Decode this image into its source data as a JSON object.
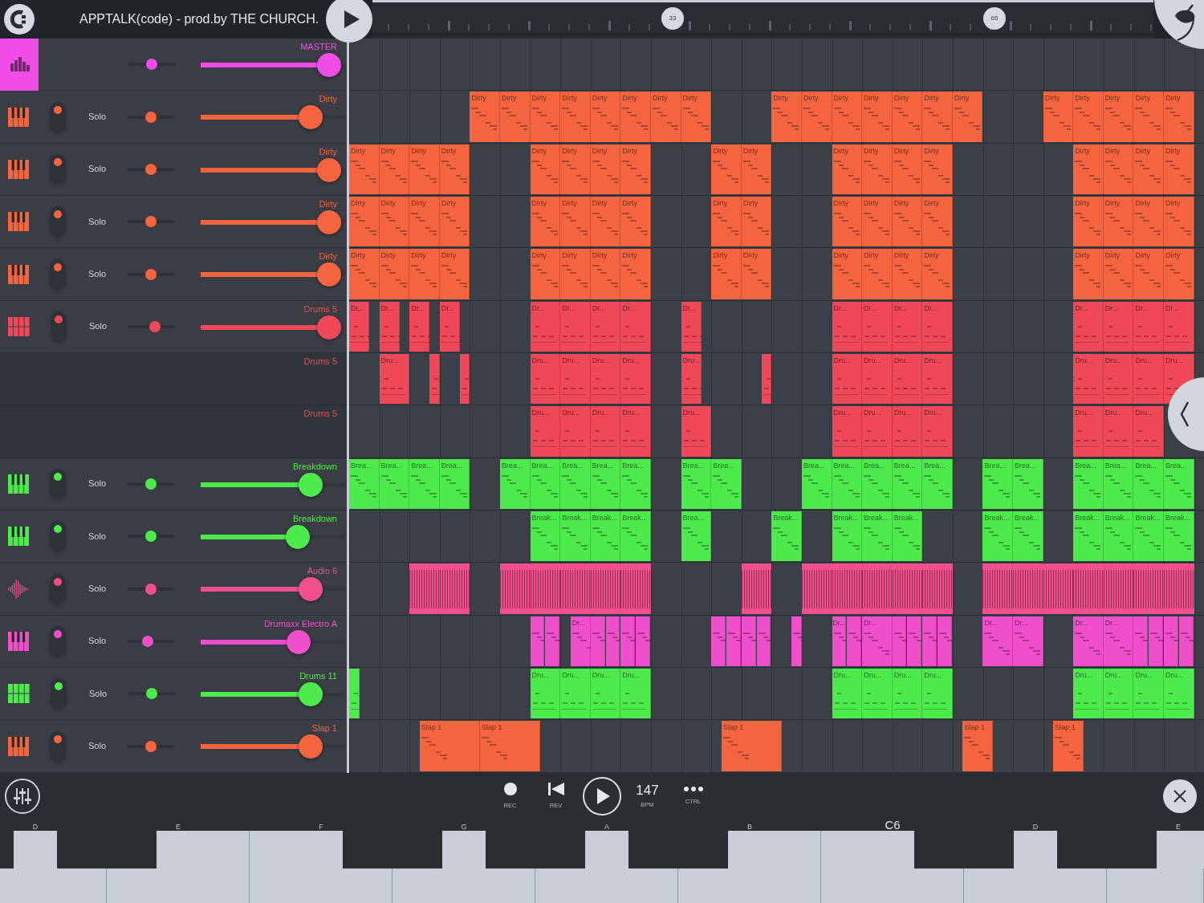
{
  "header": {
    "title": "APPTALK(code) - prod.by THE CHURCH.",
    "markers": [
      "33",
      "65"
    ]
  },
  "tracks": [
    {
      "kind": "master",
      "name": "MASTER",
      "color": "#f04ce6",
      "pan": {
        "level": 0.5
      },
      "volume": {
        "level": 0.89
      }
    },
    {
      "kind": "keys",
      "name": "Dirty",
      "color": "#f4653f",
      "on": true,
      "solo": "Solo",
      "pan": {
        "level": 0.5
      },
      "volume": {
        "level": 0.76
      },
      "slots": [
        {
          "kind": "rest"
        },
        {
          "kind": "rest"
        },
        {
          "kind": "rest"
        },
        {
          "kind": "rest"
        },
        {
          "kind": "pattern",
          "label": "Dirty"
        },
        {
          "kind": "pattern",
          "label": "Dirty"
        },
        {
          "kind": "pattern",
          "label": "Dirty"
        },
        {
          "kind": "pattern",
          "label": "Dirty"
        },
        {
          "kind": "pattern",
          "label": "Dirty"
        },
        {
          "kind": "pattern",
          "label": "Dirty"
        },
        {
          "kind": "pattern",
          "label": "Dirty"
        },
        {
          "kind": "pattern",
          "label": "Dirty"
        },
        {
          "kind": "rest"
        },
        {
          "kind": "rest"
        },
        {
          "kind": "pattern",
          "label": "Dirty"
        },
        {
          "kind": "pattern",
          "label": "Dirty"
        },
        {
          "kind": "pattern",
          "label": "Dirty"
        },
        {
          "kind": "pattern",
          "label": "Dirty"
        },
        {
          "kind": "pattern",
          "label": "Dirty"
        },
        {
          "kind": "pattern",
          "label": "Dirty"
        },
        {
          "kind": "pattern",
          "label": "Dirty"
        },
        {
          "kind": "rest"
        },
        {
          "kind": "rest"
        },
        {
          "kind": "pattern",
          "label": "Dirty"
        },
        {
          "kind": "pattern",
          "label": "Dirty"
        },
        {
          "kind": "pattern",
          "label": "Dirty"
        },
        {
          "kind": "pattern",
          "label": "Dirty"
        },
        {
          "kind": "pattern",
          "label": "Dirty"
        }
      ]
    },
    {
      "kind": "keys",
      "name": "Dirty",
      "color": "#f4653f",
      "on": true,
      "solo": "Solo",
      "pan": {
        "level": 0.5
      },
      "volume": {
        "level": 0.89
      },
      "slots": [
        {
          "kind": "pattern",
          "label": "Dirty"
        },
        {
          "kind": "pattern",
          "label": "Dirty"
        },
        {
          "kind": "pattern",
          "label": "Dirty"
        },
        {
          "kind": "pattern",
          "label": "Dirty"
        },
        {
          "kind": "rest"
        },
        {
          "kind": "rest"
        },
        {
          "kind": "pattern",
          "label": "Dirty"
        },
        {
          "kind": "pattern",
          "label": "Dirty"
        },
        {
          "kind": "pattern",
          "label": "Dirty"
        },
        {
          "kind": "pattern",
          "label": "Dirty"
        },
        {
          "kind": "rest"
        },
        {
          "kind": "rest"
        },
        {
          "kind": "pattern",
          "label": "Dirty"
        },
        {
          "kind": "pattern",
          "label": "Dirty"
        },
        {
          "kind": "rest"
        },
        {
          "kind": "rest"
        },
        {
          "kind": "pattern",
          "label": "Dirty"
        },
        {
          "kind": "pattern",
          "label": "Dirty"
        },
        {
          "kind": "pattern",
          "label": "Dirty"
        },
        {
          "kind": "pattern",
          "label": "Dirty"
        },
        {
          "kind": "rest"
        },
        {
          "kind": "rest"
        },
        {
          "kind": "rest"
        },
        {
          "kind": "rest"
        },
        {
          "kind": "pattern",
          "label": "Dirty"
        },
        {
          "kind": "pattern",
          "label": "Dirty"
        },
        {
          "kind": "pattern",
          "label": "Dirty"
        },
        {
          "kind": "pattern",
          "label": "Dirty"
        }
      ]
    },
    {
      "kind": "keys",
      "name": "Dirty",
      "color": "#f4653f",
      "on": true,
      "solo": "Solo",
      "pan": {
        "level": 0.5
      },
      "volume": {
        "level": 0.89
      },
      "slots": [
        {
          "kind": "pattern",
          "label": "Dirty"
        },
        {
          "kind": "pattern",
          "label": "Dirty"
        },
        {
          "kind": "pattern",
          "label": "Dirty"
        },
        {
          "kind": "pattern",
          "label": "Dirty"
        },
        {
          "kind": "rest"
        },
        {
          "kind": "rest"
        },
        {
          "kind": "pattern",
          "label": "Dirty"
        },
        {
          "kind": "pattern",
          "label": "Dirty"
        },
        {
          "kind": "pattern",
          "label": "Dirty"
        },
        {
          "kind": "pattern",
          "label": "Dirty"
        },
        {
          "kind": "rest"
        },
        {
          "kind": "rest"
        },
        {
          "kind": "pattern",
          "label": "Dirty"
        },
        {
          "kind": "pattern",
          "label": "Dirty"
        },
        {
          "kind": "rest"
        },
        {
          "kind": "rest"
        },
        {
          "kind": "pattern",
          "label": "Dirty"
        },
        {
          "kind": "pattern",
          "label": "Dirty"
        },
        {
          "kind": "pattern",
          "label": "Dirty"
        },
        {
          "kind": "pattern",
          "label": "Dirty"
        },
        {
          "kind": "rest"
        },
        {
          "kind": "rest"
        },
        {
          "kind": "rest"
        },
        {
          "kind": "rest"
        },
        {
          "kind": "pattern",
          "label": "Dirty"
        },
        {
          "kind": "pattern",
          "label": "Dirty"
        },
        {
          "kind": "pattern",
          "label": "Dirty"
        },
        {
          "kind": "pattern",
          "label": "Dirty"
        }
      ]
    },
    {
      "kind": "keys",
      "name": "Dirty",
      "color": "#f4653f",
      "on": true,
      "solo": "Solo",
      "pan": {
        "level": 0.5
      },
      "volume": {
        "level": 0.89
      },
      "slots": [
        {
          "kind": "pattern",
          "label": "Dirty"
        },
        {
          "kind": "pattern",
          "label": "Dirty"
        },
        {
          "kind": "pattern",
          "label": "Dirty"
        },
        {
          "kind": "pattern",
          "label": "Dirty"
        },
        {
          "kind": "rest"
        },
        {
          "kind": "rest"
        },
        {
          "kind": "pattern",
          "label": "Dirty"
        },
        {
          "kind": "pattern",
          "label": "Dirty"
        },
        {
          "kind": "pattern",
          "label": "Dirty"
        },
        {
          "kind": "pattern",
          "label": "Dirty"
        },
        {
          "kind": "rest"
        },
        {
          "kind": "rest"
        },
        {
          "kind": "pattern",
          "label": "Dirty"
        },
        {
          "kind": "pattern",
          "label": "Dirty"
        },
        {
          "kind": "rest"
        },
        {
          "kind": "rest"
        },
        {
          "kind": "pattern",
          "label": "Dirty"
        },
        {
          "kind": "pattern",
          "label": "Dirty"
        },
        {
          "kind": "pattern",
          "label": "Dirty"
        },
        {
          "kind": "pattern",
          "label": "Dirty"
        },
        {
          "kind": "rest"
        },
        {
          "kind": "rest"
        },
        {
          "kind": "rest"
        },
        {
          "kind": "rest"
        },
        {
          "kind": "pattern",
          "label": "Dirty"
        },
        {
          "kind": "pattern",
          "label": "Dirty"
        },
        {
          "kind": "pattern",
          "label": "Dirty"
        },
        {
          "kind": "pattern",
          "label": "Dirty"
        }
      ]
    },
    {
      "kind": "drums",
      "name": "Drums 5",
      "color": "#ef4858",
      "on": true,
      "solo": "Solo",
      "pan": {
        "level": 0.57
      },
      "volume": {
        "level": 0.89
      },
      "slots": [
        {
          "kind": "short",
          "label": "Dr..."
        },
        {
          "kind": "short",
          "label": "Dr..."
        },
        {
          "kind": "short",
          "label": "Dr..."
        },
        {
          "kind": "short",
          "label": "Dr..."
        },
        {
          "kind": "rest"
        },
        {
          "kind": "rest"
        },
        {
          "kind": "pattern",
          "label": "Dr..."
        },
        {
          "kind": "pattern",
          "label": "Dr..."
        },
        {
          "kind": "pattern",
          "label": "Dr..."
        },
        {
          "kind": "pattern",
          "label": "Dr..."
        },
        {
          "kind": "rest"
        },
        {
          "kind": "short",
          "label": "Dr..."
        },
        {
          "kind": "rest"
        },
        {
          "kind": "rest"
        },
        {
          "kind": "rest"
        },
        {
          "kind": "rest"
        },
        {
          "kind": "pattern",
          "label": "Dr..."
        },
        {
          "kind": "pattern",
          "label": "Dr..."
        },
        {
          "kind": "pattern",
          "label": "Dr..."
        },
        {
          "kind": "pattern",
          "label": "Dr..."
        },
        {
          "kind": "rest"
        },
        {
          "kind": "rest"
        },
        {
          "kind": "rest"
        },
        {
          "kind": "rest"
        },
        {
          "kind": "pattern",
          "label": "Dr..."
        },
        {
          "kind": "pattern",
          "label": "Dr..."
        },
        {
          "kind": "pattern",
          "label": "Dr..."
        },
        {
          "kind": "pattern",
          "label": "Dr..."
        }
      ]
    },
    {
      "kind": "lane",
      "name": "Drums 5",
      "color": "#ef4858",
      "slots": [
        {
          "kind": "rest"
        },
        {
          "kind": "pattern",
          "label": "Dru..."
        },
        {
          "kind": "tail"
        },
        {
          "kind": "tail"
        },
        {
          "kind": "rest"
        },
        {
          "kind": "rest"
        },
        {
          "kind": "pattern",
          "label": "Dru..."
        },
        {
          "kind": "pattern",
          "label": "Dru..."
        },
        {
          "kind": "pattern",
          "label": "Dru..."
        },
        {
          "kind": "pattern",
          "label": "Dru..."
        },
        {
          "kind": "rest"
        },
        {
          "kind": "short",
          "label": "Dru..."
        },
        {
          "kind": "rest"
        },
        {
          "kind": "tail"
        },
        {
          "kind": "rest"
        },
        {
          "kind": "rest"
        },
        {
          "kind": "pattern",
          "label": "Dru..."
        },
        {
          "kind": "pattern",
          "label": "Dru..."
        },
        {
          "kind": "pattern",
          "label": "Dru..."
        },
        {
          "kind": "pattern",
          "label": "Dru..."
        },
        {
          "kind": "rest"
        },
        {
          "kind": "rest"
        },
        {
          "kind": "rest"
        },
        {
          "kind": "rest"
        },
        {
          "kind": "pattern",
          "label": "Dru..."
        },
        {
          "kind": "pattern",
          "label": "Dru..."
        },
        {
          "kind": "pattern",
          "label": "Dru..."
        },
        {
          "kind": "pattern",
          "label": "Dru..."
        }
      ]
    },
    {
      "kind": "lane",
      "name": "Drums 5",
      "color": "#ef4858",
      "slots": [
        {
          "kind": "rest"
        },
        {
          "kind": "rest"
        },
        {
          "kind": "rest"
        },
        {
          "kind": "rest"
        },
        {
          "kind": "rest"
        },
        {
          "kind": "rest"
        },
        {
          "kind": "pattern",
          "label": "Dru..."
        },
        {
          "kind": "pattern",
          "label": "Dru..."
        },
        {
          "kind": "pattern",
          "label": "Dru..."
        },
        {
          "kind": "pattern",
          "label": "Dru..."
        },
        {
          "kind": "rest"
        },
        {
          "kind": "pattern",
          "label": "Dru..."
        },
        {
          "kind": "rest"
        },
        {
          "kind": "rest"
        },
        {
          "kind": "rest"
        },
        {
          "kind": "rest"
        },
        {
          "kind": "pattern",
          "label": "Dru..."
        },
        {
          "kind": "pattern",
          "label": "Dru..."
        },
        {
          "kind": "pattern",
          "label": "Dru..."
        },
        {
          "kind": "pattern",
          "label": "Dru..."
        },
        {
          "kind": "rest"
        },
        {
          "kind": "rest"
        },
        {
          "kind": "rest"
        },
        {
          "kind": "rest"
        },
        {
          "kind": "pattern",
          "label": "Dru..."
        },
        {
          "kind": "pattern",
          "label": "Dru..."
        },
        {
          "kind": "pattern",
          "label": "Dru..."
        }
      ]
    },
    {
      "kind": "keys",
      "name": "Breakdown",
      "color": "#4cea4b",
      "on": true,
      "solo": "Solo",
      "pan": {
        "level": 0.5
      },
      "volume": {
        "level": 0.76
      },
      "slots": [
        {
          "kind": "pattern",
          "label": "Brea..."
        },
        {
          "kind": "pattern",
          "label": "Brea..."
        },
        {
          "kind": "pattern",
          "label": "Brea..."
        },
        {
          "kind": "pattern",
          "label": "Brea..."
        },
        {
          "kind": "rest"
        },
        {
          "kind": "pattern",
          "label": "Brea..."
        },
        {
          "kind": "pattern",
          "label": "Brea..."
        },
        {
          "kind": "pattern",
          "label": "Brea..."
        },
        {
          "kind": "pattern",
          "label": "Brea..."
        },
        {
          "kind": "pattern",
          "label": "Brea..."
        },
        {
          "kind": "rest"
        },
        {
          "kind": "pattern",
          "label": "Brea..."
        },
        {
          "kind": "pattern",
          "label": "Brea..."
        },
        {
          "kind": "rest"
        },
        {
          "kind": "rest"
        },
        {
          "kind": "pattern",
          "label": "Brea..."
        },
        {
          "kind": "pattern",
          "label": "Brea..."
        },
        {
          "kind": "pattern",
          "label": "Brea..."
        },
        {
          "kind": "pattern",
          "label": "Brea..."
        },
        {
          "kind": "pattern",
          "label": "Brea..."
        },
        {
          "kind": "rest"
        },
        {
          "kind": "pattern",
          "label": "Brea..."
        },
        {
          "kind": "pattern",
          "label": "Brea..."
        },
        {
          "kind": "rest"
        },
        {
          "kind": "pattern",
          "label": "Brea..."
        },
        {
          "kind": "pattern",
          "label": "Brea..."
        },
        {
          "kind": "pattern",
          "label": "Brea..."
        },
        {
          "kind": "pattern",
          "label": "Brea..."
        }
      ]
    },
    {
      "kind": "keys",
      "name": "Breakdown",
      "color": "#4cea4b",
      "on": true,
      "solo": "Solo",
      "pan": {
        "level": 0.5
      },
      "volume": {
        "level": 0.67
      },
      "slots": [
        {
          "kind": "rest"
        },
        {
          "kind": "rest"
        },
        {
          "kind": "rest"
        },
        {
          "kind": "rest"
        },
        {
          "kind": "rest"
        },
        {
          "kind": "rest"
        },
        {
          "kind": "pattern",
          "label": "Break..."
        },
        {
          "kind": "pattern",
          "label": "Break..."
        },
        {
          "kind": "pattern",
          "label": "Break..."
        },
        {
          "kind": "pattern",
          "label": "Break..."
        },
        {
          "kind": "rest"
        },
        {
          "kind": "pattern",
          "label": "Brea..."
        },
        {
          "kind": "rest"
        },
        {
          "kind": "rest"
        },
        {
          "kind": "pattern",
          "label": "Break..."
        },
        {
          "kind": "rest"
        },
        {
          "kind": "pattern",
          "label": "Break..."
        },
        {
          "kind": "pattern",
          "label": "Break..."
        },
        {
          "kind": "pattern",
          "label": "Break..."
        },
        {
          "kind": "rest"
        },
        {
          "kind": "rest"
        },
        {
          "kind": "pattern",
          "label": "Break..."
        },
        {
          "kind": "pattern",
          "label": "Break..."
        },
        {
          "kind": "rest"
        },
        {
          "kind": "pattern",
          "label": "Break..."
        },
        {
          "kind": "pattern",
          "label": "Break..."
        },
        {
          "kind": "pattern",
          "label": "Break..."
        },
        {
          "kind": "pattern",
          "label": "Break..."
        }
      ]
    },
    {
      "kind": "audio",
      "name": "Audio 6",
      "color": "#f04f8b",
      "on": true,
      "solo": "Solo",
      "pan": {
        "level": 0.5
      },
      "volume": {
        "level": 0.76
      },
      "slots": [
        {
          "kind": "rest"
        },
        {
          "kind": "rest"
        },
        {
          "kind": "audio"
        },
        {
          "kind": "audio"
        },
        {
          "kind": "rest"
        },
        {
          "kind": "audio"
        },
        {
          "kind": "audio"
        },
        {
          "kind": "audio"
        },
        {
          "kind": "audio"
        },
        {
          "kind": "audio"
        },
        {
          "kind": "rest"
        },
        {
          "kind": "rest"
        },
        {
          "kind": "rest"
        },
        {
          "kind": "audio"
        },
        {
          "kind": "rest"
        },
        {
          "kind": "audio"
        },
        {
          "kind": "audio"
        },
        {
          "kind": "audio"
        },
        {
          "kind": "audio"
        },
        {
          "kind": "audio"
        },
        {
          "kind": "rest"
        },
        {
          "kind": "audio"
        },
        {
          "kind": "audio"
        },
        {
          "kind": "audio"
        },
        {
          "kind": "audio"
        },
        {
          "kind": "audio"
        },
        {
          "kind": "audio"
        },
        {
          "kind": "audio"
        }
      ]
    },
    {
      "kind": "keys",
      "name": "Drumaxx Electro A",
      "color": "#f04fcb",
      "on": true,
      "solo": "Solo",
      "pan": {
        "level": 0.43
      },
      "volume": {
        "level": 0.68
      },
      "slots": [
        {
          "kind": "rest"
        },
        {
          "kind": "rest"
        },
        {
          "kind": "rest"
        },
        {
          "kind": "rest"
        },
        {
          "kind": "rest"
        },
        {
          "kind": "rest"
        },
        {
          "kind": "split"
        },
        {
          "kind": "late",
          "label": "Dr..."
        },
        {
          "kind": "split"
        },
        {
          "kind": "split"
        },
        {
          "kind": "rest"
        },
        {
          "kind": "rest"
        },
        {
          "kind": "split"
        },
        {
          "kind": "split"
        },
        {
          "kind": "tail"
        },
        {
          "kind": "rest"
        },
        {
          "kind": "split",
          "label": "Dr..."
        },
        {
          "kind": "pattern",
          "label": "Dr..."
        },
        {
          "kind": "split"
        },
        {
          "kind": "split"
        },
        {
          "kind": "rest"
        },
        {
          "kind": "pattern",
          "label": "Dr..."
        },
        {
          "kind": "pattern",
          "label": "Dr..."
        },
        {
          "kind": "rest"
        },
        {
          "kind": "pattern",
          "label": "Dr..."
        },
        {
          "kind": "pattern",
          "label": "Dr..."
        },
        {
          "kind": "split"
        },
        {
          "kind": "split"
        }
      ]
    },
    {
      "kind": "drums",
      "name": "Drums 11",
      "color": "#4cea4b",
      "on": true,
      "solo": "Solo",
      "pan": {
        "level": 0.5
      },
      "volume": {
        "level": 0.76
      },
      "slots": [
        {
          "kind": "sliver"
        },
        {
          "kind": "rest"
        },
        {
          "kind": "rest"
        },
        {
          "kind": "rest"
        },
        {
          "kind": "rest"
        },
        {
          "kind": "rest"
        },
        {
          "kind": "pattern",
          "label": "Dru..."
        },
        {
          "kind": "pattern",
          "label": "Dru..."
        },
        {
          "kind": "pattern",
          "label": "Dru..."
        },
        {
          "kind": "pattern",
          "label": "Dru..."
        },
        {
          "kind": "rest"
        },
        {
          "kind": "rest"
        },
        {
          "kind": "rest"
        },
        {
          "kind": "rest"
        },
        {
          "kind": "rest"
        },
        {
          "kind": "rest"
        },
        {
          "kind": "pattern",
          "label": "Dru..."
        },
        {
          "kind": "pattern",
          "label": "Dru..."
        },
        {
          "kind": "pattern",
          "label": "Dru..."
        },
        {
          "kind": "pattern",
          "label": "Dru..."
        },
        {
          "kind": "rest"
        },
        {
          "kind": "rest"
        },
        {
          "kind": "rest"
        },
        {
          "kind": "rest"
        },
        {
          "kind": "pattern",
          "label": "Dru..."
        },
        {
          "kind": "pattern",
          "label": "Dru..."
        },
        {
          "kind": "pattern",
          "label": "Dru..."
        },
        {
          "kind": "pattern",
          "label": "Dru..."
        }
      ]
    },
    {
      "kind": "keys",
      "name": "Slap 1",
      "color": "#f4653f",
      "on": true,
      "solo": "Solo",
      "pan": {
        "level": 0.5
      },
      "volume": {
        "level": 0.76
      },
      "slots": [
        {
          "kind": "rest"
        },
        {
          "kind": "rest"
        },
        {
          "kind": "nudge"
        },
        {
          "kind": "long",
          "label": "Slap 1"
        },
        {
          "kind": "long",
          "label": "Slap 1"
        },
        {
          "kind": "nudge"
        },
        {
          "kind": "nudge"
        },
        {
          "kind": "rest"
        },
        {
          "kind": "rest"
        },
        {
          "kind": "rest"
        },
        {
          "kind": "rest"
        },
        {
          "kind": "rest"
        },
        {
          "kind": "nudge"
        },
        {
          "kind": "long",
          "label": "Slap 1"
        },
        {
          "kind": "nudge"
        },
        {
          "kind": "nudge"
        },
        {
          "kind": "rest"
        },
        {
          "kind": "rest"
        },
        {
          "kind": "rest"
        },
        {
          "kind": "rest"
        },
        {
          "kind": "rest"
        },
        {
          "kind": "nudge"
        },
        {
          "kind": "pattern",
          "label": "Slap 1"
        },
        {
          "kind": "nudge"
        },
        {
          "kind": "nudge"
        },
        {
          "kind": "rest"
        },
        {
          "kind": "nudge"
        },
        {
          "kind": "pattern",
          "label": "Slap 1"
        }
      ]
    }
  ],
  "toolbar": [
    {
      "kind": "mixer"
    },
    {
      "kind": "record",
      "label": "REC"
    },
    {
      "kind": "rewind",
      "label": "REV"
    },
    {
      "kind": "play"
    },
    {
      "kind": "tempo",
      "value": "147",
      "label": "BPM"
    },
    {
      "kind": "more",
      "label": "CTRL"
    },
    {
      "kind": "close"
    }
  ],
  "keyboard": {
    "lead_sharp": true,
    "keys": [
      {
        "note": "D",
        "kind": "note",
        "sharp": true
      },
      {
        "note": "E",
        "kind": "note",
        "sharp": false
      },
      {
        "note": "F",
        "kind": "note",
        "sharp": true
      },
      {
        "note": "G",
        "kind": "note",
        "sharp": true
      },
      {
        "note": "A",
        "kind": "note",
        "sharp": true
      },
      {
        "note": "B",
        "kind": "note",
        "sharp": false
      },
      {
        "note": "C6",
        "kind": "octave",
        "sharp": true
      },
      {
        "note": "D",
        "kind": "note",
        "sharp": true
      },
      {
        "note": "E",
        "kind": "note",
        "sharp": false
      }
    ]
  }
}
